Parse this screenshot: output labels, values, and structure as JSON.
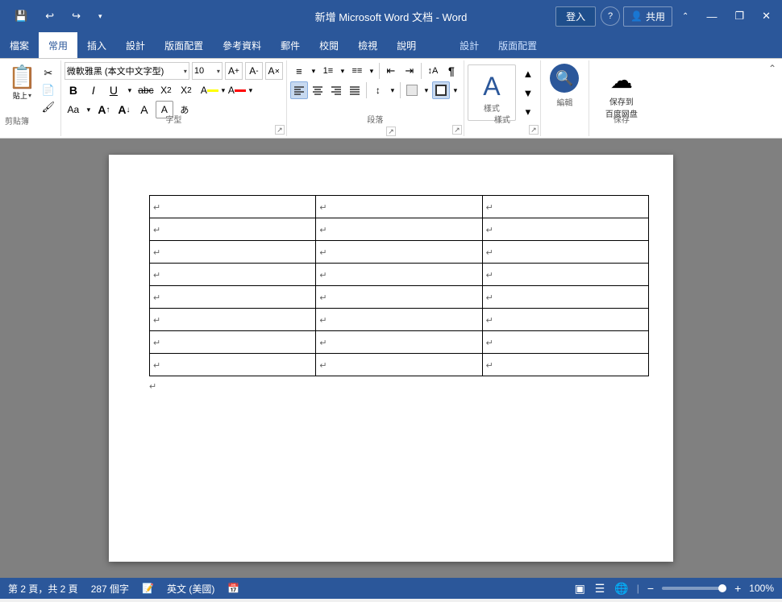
{
  "titleBar": {
    "title": "新增 Microsoft Word 文档 - Word",
    "appName": "Word",
    "loginBtn": "登入",
    "shareLabel": "共用",
    "quickAccess": {
      "save": "💾",
      "undo": "↩",
      "redo": "↪",
      "more": "▾"
    },
    "windowControls": {
      "minimize": "—",
      "maximize": "□",
      "close": "✕",
      "restore": "❐"
    },
    "accentColor": "#2b579a"
  },
  "menuBar": {
    "items": [
      {
        "label": "檔案",
        "active": false
      },
      {
        "label": "常用",
        "active": true
      },
      {
        "label": "插入",
        "active": false
      },
      {
        "label": "設計",
        "active": false
      },
      {
        "label": "版面配置",
        "active": false
      },
      {
        "label": "參考資料",
        "active": false
      },
      {
        "label": "郵件",
        "active": false
      },
      {
        "label": "校閱",
        "active": false
      },
      {
        "label": "檢視",
        "active": false
      },
      {
        "label": "說明",
        "active": false
      },
      {
        "label": "設計",
        "active": false
      },
      {
        "label": "版面配置",
        "active": false
      }
    ]
  },
  "toolbar": {
    "sections": {
      "clipboard": {
        "label": "剪貼簿",
        "paste": "貼上",
        "cut": "✂",
        "copy": "⊡",
        "paintbrush": "🖌"
      },
      "font": {
        "label": "字型",
        "fontName": "微軟雅黑 (本文中文字型)",
        "fontSize": "10",
        "bold": "B",
        "italic": "I",
        "underline": "U",
        "strikethrough": "abc",
        "subscript": "X₂",
        "superscript": "X²",
        "clearFormat": "✕",
        "fontColor": "A",
        "highlightColor": "A",
        "textColorA": "A",
        "textCase": "Aa",
        "sizeIncrease": "A↑",
        "sizeDecrease": "A↓",
        "fontFormat": "A"
      },
      "paragraph": {
        "label": "段落",
        "bullets": "≡",
        "numbering": "≡",
        "multiLevel": "≡",
        "decreaseIndent": "⇤",
        "increaseIndent": "⇥",
        "sort": "↕A",
        "showMarks": "¶",
        "alignLeft": "≡",
        "alignCenter": "≡",
        "alignRight": "≡",
        "justify": "≡",
        "lineSpacing": "↕",
        "shading": "▦",
        "border": "□"
      },
      "style": {
        "label": "樣式",
        "styleIcon": "A",
        "editLabel": "編輯"
      },
      "editing": {
        "label": "編輯",
        "searchIcon": "🔍"
      },
      "save": {
        "label": "保存",
        "saveLabel": "保存到\n百度网盘",
        "icon": "☁"
      }
    }
  },
  "document": {
    "table": {
      "rows": 8,
      "cols": 3,
      "cellMark": "↵"
    },
    "paragraphMark": "↵"
  },
  "statusBar": {
    "page": "第 2 頁，共 2 頁",
    "wordCount": "287 個字",
    "language": "英文 (美國)",
    "proofing": "📝",
    "calendarIcon": "📅",
    "zoom": "100%",
    "viewNormal": "▣",
    "viewRead": "📖",
    "viewWeb": "🌐"
  }
}
